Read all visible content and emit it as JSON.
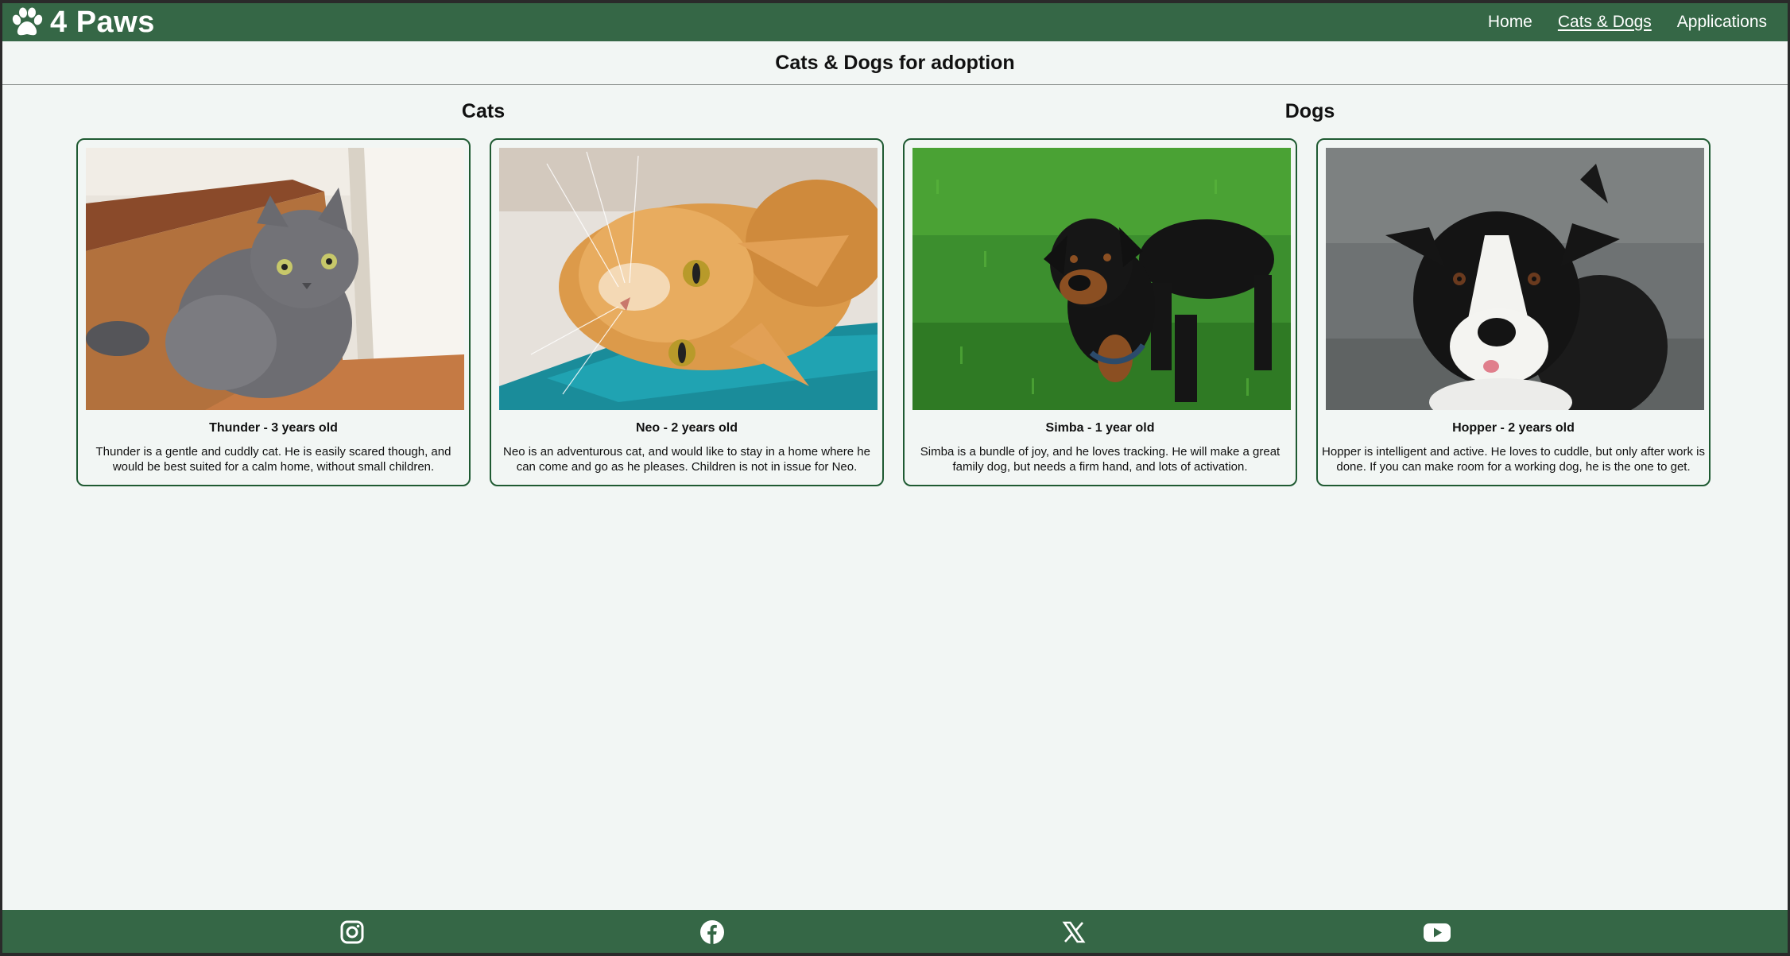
{
  "brand": {
    "name": "4 Paws",
    "icon": "paw-icon"
  },
  "nav": {
    "items": [
      {
        "label": "Home",
        "active": false
      },
      {
        "label": "Cats & Dogs",
        "active": true
      },
      {
        "label": "Applications",
        "active": false
      }
    ]
  },
  "page": {
    "title": "Cats & Dogs for adoption"
  },
  "sections": {
    "cats_heading": "Cats",
    "dogs_heading": "Dogs"
  },
  "animals": [
    {
      "name": "Thunder - 3 years old",
      "description": "Thunder is a gentle and cuddly cat. He is easily scared though, and would be best suited for a calm home, without small children.",
      "photo": "grey-cat-photo"
    },
    {
      "name": "Neo - 2 years old",
      "description": "Neo is an adventurous cat, and would like to stay in a home where he can come and go as he pleases. Children is not in issue for Neo.",
      "photo": "orange-cat-photo"
    },
    {
      "name": "Simba - 1 year old",
      "description": "Simba is a bundle of joy, and he loves tracking. He will make a great family dog, but needs a firm hand, and lots of activation.",
      "photo": "rottweiler-photo"
    },
    {
      "name": "Hopper - 2 years old",
      "description": "Hopper is intelligent and active. He loves to cuddle, but only after work is done. If you can make room for a working dog, he is the one to get.",
      "photo": "border-collie-photo"
    }
  ],
  "footer": {
    "social": [
      "instagram-icon",
      "facebook-icon",
      "x-icon",
      "youtube-icon"
    ]
  },
  "colors": {
    "header_bg": "#356746",
    "page_bg": "#f2f6f4",
    "card_border": "#1f5a32"
  }
}
